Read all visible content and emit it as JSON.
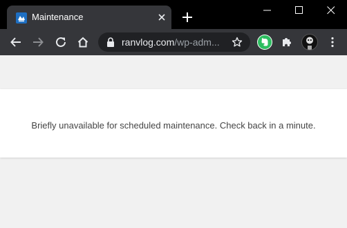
{
  "tab": {
    "title": "Maintenance",
    "favicon": "wordpress-maintenance-favicon"
  },
  "address_bar": {
    "domain": "ranvlog.com",
    "path": "/wp-adm...",
    "secure_icon": "lock-icon"
  },
  "toolbar": {
    "icons": [
      "back-arrow-icon",
      "forward-arrow-icon",
      "reload-icon",
      "home-icon",
      "star-icon",
      "evernote-icon",
      "puzzle-icon",
      "avatar",
      "menu-dots-icon"
    ]
  },
  "window_controls": [
    "minimize-icon",
    "maximize-icon",
    "close-icon"
  ],
  "page": {
    "message": "Briefly unavailable for scheduled maintenance. Check back in a minute."
  },
  "colors": {
    "titlebar": "#000000",
    "tab": "#35363a",
    "toolbar": "#35363a",
    "omnibox": "#202124",
    "page_background": "#f1f1f1",
    "notice_background": "#ffffff",
    "notice_text": "#444444",
    "evernote_green": "#2dbe60"
  }
}
